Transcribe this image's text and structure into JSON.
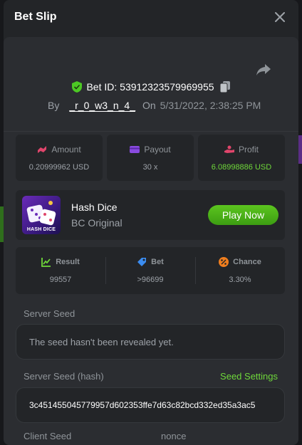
{
  "modal": {
    "title": "Bet Slip"
  },
  "bet": {
    "id_label": "Bet ID: 53912323579969955",
    "by_label": "By",
    "username": "_r_0_w3_n_4_",
    "on_label": "On",
    "date": "5/31/2022, 2:38:25 PM"
  },
  "stats": [
    {
      "icon": "amount-icon",
      "label": "Amount",
      "value": "0.20999962 USD",
      "color": "#e0456b"
    },
    {
      "icon": "payout-icon",
      "label": "Payout",
      "value": "30 x",
      "color": "#8a4be0"
    },
    {
      "icon": "profit-icon",
      "label": "Profit",
      "value": "6.08998886 USD",
      "color": "#e0456b",
      "value_color": "#6fd83a"
    }
  ],
  "game": {
    "name": "Hash Dice",
    "subtitle": "BC Original",
    "thumb_label": "HASH DICE",
    "play_label": "Play Now"
  },
  "result": [
    {
      "icon": "result-icon",
      "label": "Result",
      "value": "99557",
      "color": "#6fd83a"
    },
    {
      "icon": "bet-icon",
      "label": "Bet",
      "value": ">96699",
      "color": "#3b8cf0"
    },
    {
      "icon": "chance-icon",
      "label": "Chance",
      "value": "3.30%",
      "color": "#f07e1e"
    }
  ],
  "server_seed": {
    "label": "Server Seed",
    "value": "The seed hasn't been revealed yet."
  },
  "server_seed_hash": {
    "label": "Server Seed (hash)",
    "settings_label": "Seed Settings",
    "value": "3c451455045779957d602353ffe7d63c82bcd332ed35a3ac5"
  },
  "client_seed": {
    "label": "Client Seed"
  },
  "nonce": {
    "label": "nonce"
  },
  "colors": {
    "accent_green": "#6fd83a",
    "panel": "#2b2d31",
    "card": "#232528"
  }
}
